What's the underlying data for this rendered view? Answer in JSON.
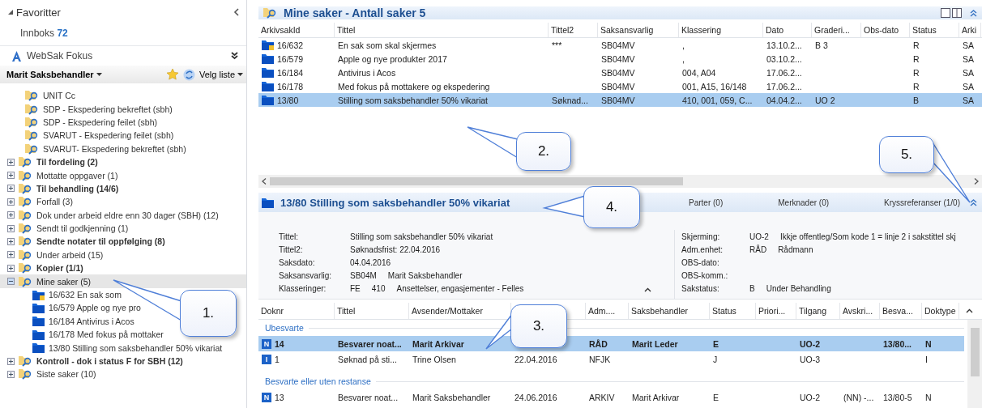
{
  "sidebar": {
    "favorites": {
      "title": "Favoritter",
      "expanded": true
    },
    "inbox": {
      "label": "Innboks",
      "count": "72"
    },
    "app": {
      "title": "WebSak Fokus"
    },
    "user_menu": {
      "label": "Marit Saksbehandler"
    },
    "list_menu": {
      "label": "Velg liste"
    },
    "tree": [
      {
        "label": "UNIT Cc",
        "bold": false,
        "expandable": false,
        "selected": false
      },
      {
        "label": "SDP - Ekspedering bekreftet (sbh)",
        "bold": false,
        "expandable": false,
        "selected": false
      },
      {
        "label": "SDP - Ekspedering feilet (sbh)",
        "bold": false,
        "expandable": false,
        "selected": false
      },
      {
        "label": "SVARUT - Ekspedering feilet (sbh)",
        "bold": false,
        "expandable": false,
        "selected": false
      },
      {
        "label": "SVARUT- Ekspedering bekreftet (sbh)",
        "bold": false,
        "expandable": false,
        "selected": false
      },
      {
        "label": "Til fordeling (2)",
        "bold": true,
        "expandable": true,
        "expanded": false,
        "selected": false
      },
      {
        "label": "Mottatte oppgaver (1)",
        "bold": false,
        "expandable": true,
        "expanded": false,
        "selected": false
      },
      {
        "label": "Til behandling (14/6)",
        "bold": true,
        "expandable": true,
        "expanded": false,
        "selected": false
      },
      {
        "label": "Forfall (3)",
        "bold": false,
        "expandable": true,
        "expanded": false,
        "selected": false
      },
      {
        "label": "Dok under arbeid eldre enn 30 dager (SBH) (12)",
        "bold": false,
        "expandable": true,
        "expanded": false,
        "selected": false
      },
      {
        "label": "Sendt til godkjenning (1)",
        "bold": false,
        "expandable": true,
        "expanded": false,
        "selected": false
      },
      {
        "label": "Sendte notater til oppfølging (8)",
        "bold": true,
        "expandable": true,
        "expanded": false,
        "selected": false
      },
      {
        "label": "Under arbeid (15)",
        "bold": false,
        "expandable": true,
        "expanded": false,
        "selected": false
      },
      {
        "label": "Kopier (1/1)",
        "bold": true,
        "expandable": true,
        "expanded": false,
        "selected": false
      },
      {
        "label": "Mine saker (5)",
        "bold": false,
        "expandable": true,
        "expanded": true,
        "selected": true,
        "children": [
          {
            "label": "16/632 En sak som",
            "locked": true
          },
          {
            "label": "16/579 Apple og nye pro",
            "locked": false
          },
          {
            "label": "16/184 Antivirus i Acos",
            "locked": false
          },
          {
            "label": "16/178 Med fokus på mottaker",
            "locked": false
          },
          {
            "label": "13/80 Stilling som saksbehandler 50% vikariat",
            "locked": false
          }
        ]
      },
      {
        "label": "Kontroll - dok i status F for SBH (12)",
        "bold": true,
        "expandable": true,
        "expanded": false,
        "selected": false
      },
      {
        "label": "Siste saker (10)",
        "bold": false,
        "expandable": true,
        "expanded": false,
        "selected": false
      }
    ]
  },
  "cases": {
    "title": "Mine saker - Antall saker 5",
    "columns": [
      "ArkivsakId",
      "Tittel",
      "Tittel2",
      "Saksansvarlig",
      "Klassering",
      "Dato",
      "Graderi...",
      "Obs-dato",
      "Status",
      "Arki"
    ],
    "rows": [
      {
        "locked": true,
        "selected": false,
        "cells": [
          "16/632",
          "En sak som skal skjermes",
          "***",
          "SB04MV",
          ",",
          "13.10.2...",
          "B 3",
          null,
          "R",
          "SA"
        ]
      },
      {
        "locked": false,
        "selected": false,
        "cells": [
          "16/579",
          "Apple og nye produkter 2017",
          null,
          "SB04MV",
          ",",
          "03.10.2...",
          null,
          null,
          "R",
          "SA"
        ]
      },
      {
        "locked": false,
        "selected": false,
        "cells": [
          "16/184",
          "Antivirus i Acos",
          null,
          "SB04MV",
          "004, A04",
          "17.06.2...",
          null,
          null,
          "R",
          "SA"
        ]
      },
      {
        "locked": false,
        "selected": false,
        "cells": [
          "16/178",
          "Med fokus på mottakere og ekspedering",
          null,
          "SB04MV",
          "001, A15, 16/148",
          "17.06.2...",
          null,
          null,
          "R",
          "SA"
        ]
      },
      {
        "locked": false,
        "selected": true,
        "cells": [
          "13/80",
          "Stilling som saksbehandler 50% vikariat",
          "Søknad...",
          "SB04MV",
          "410, 001, 059, C...",
          "04.04.2...",
          "UO 2",
          null,
          "B",
          "SA"
        ]
      }
    ]
  },
  "detail": {
    "title": "13/80  Stilling som saksbehandler 50% vikariat",
    "tabs": [
      "Parter (0)",
      "Merknader (0)",
      "Kryssreferanser (1/0)"
    ],
    "left_fields": [
      {
        "label": "Tittel:",
        "values": [
          "Stilling som saksbehandler 50% vikariat"
        ]
      },
      {
        "label": "Tittel2:",
        "values": [
          "Søknadsfrist: 22.04.2016"
        ]
      },
      {
        "label": "Saksdato:",
        "values": [
          "04.04.2016"
        ]
      },
      {
        "label": "Saksansvarlig:",
        "values": [
          "SB04M",
          "Marit Saksbehandler"
        ]
      },
      {
        "label": "Klasseringer:",
        "values": [
          "FE",
          "410",
          "Ansettelser, engasjementer - Felles"
        ]
      }
    ],
    "right_fields": [
      {
        "label": "Skjerming:",
        "values": [
          "UO-2",
          "Ikkje offentleg/Som kode 1 = linje 2 i sakstittel skj"
        ]
      },
      {
        "label": "Adm.enhet:",
        "values": [
          "RÅD",
          "Rådmann"
        ]
      },
      {
        "label": "OBS-dato:"
      },
      {
        "label": "OBS-komm.:"
      },
      {
        "label": "Sakstatus:",
        "values": [
          "B",
          "Under Behandling"
        ]
      }
    ]
  },
  "documents": {
    "columns": [
      {
        "label": "Doknr"
      },
      {
        "label": "Tittel"
      },
      {
        "label": "Avsender/Mottaker"
      },
      {},
      {
        "label": "Adm...."
      },
      {
        "label": "Saksbehandler"
      },
      {
        "label": "Status"
      },
      {
        "label": "Priori..."
      },
      {
        "label": "Tilgang"
      },
      {
        "label": "Avskri..."
      },
      {
        "label": "Besva..."
      },
      {
        "label": "Doktype"
      }
    ],
    "rows": [
      {
        "kind": "group",
        "label": "Ubesvarte"
      },
      {
        "kind": "doc",
        "badge": "N",
        "selected": true,
        "bold": true,
        "cells": [
          "14",
          "Besvarer noat...",
          "Marit Arkivar",
          null,
          "RÅD",
          "Marit Leder",
          "E",
          null,
          "UO-2",
          null,
          "13/80...",
          "N"
        ]
      },
      {
        "kind": "doc",
        "badge": "I",
        "selected": false,
        "bold": false,
        "cells": [
          "1",
          "Søknad på sti...",
          "Trine Olsen",
          "22.04.2016",
          "NFJK",
          null,
          "J",
          null,
          "UO-3",
          null,
          null,
          "I"
        ]
      },
      {
        "kind": "group",
        "label": "Besvarte eller uten restanse"
      },
      {
        "kind": "doc",
        "badge": "N",
        "selected": false,
        "bold": false,
        "cells": [
          "13",
          "Besvarer noat...",
          "Marit Saksbehandler",
          "24.06.2016",
          "ARKIV",
          "Marit Arkivar",
          "E",
          null,
          "UO-2",
          "(NN) -...",
          "13/80-5",
          "N"
        ]
      }
    ]
  },
  "callouts": [
    {
      "label": "1."
    },
    {
      "label": "2."
    },
    {
      "label": "3."
    },
    {
      "label": "4."
    },
    {
      "label": "5."
    }
  ]
}
